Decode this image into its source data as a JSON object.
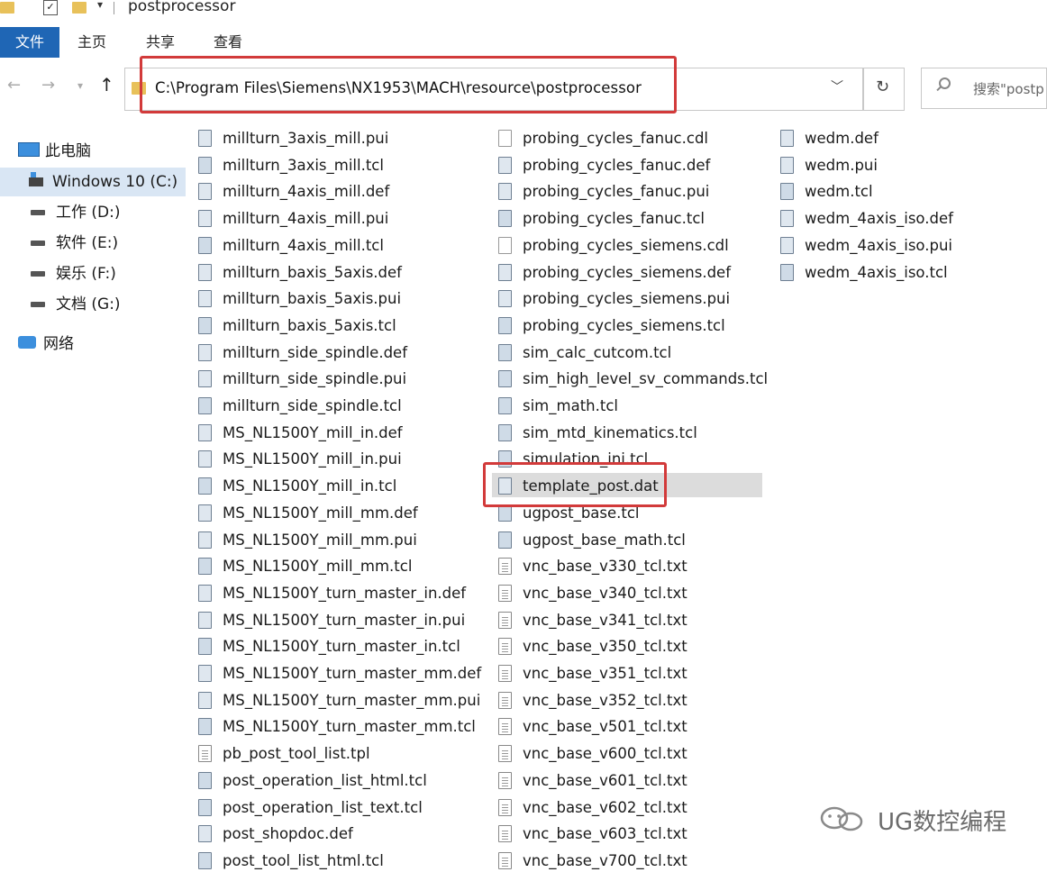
{
  "window": {
    "title": "postprocessor"
  },
  "ribbon": {
    "tabs": [
      "文件",
      "主页",
      "共享",
      "查看"
    ]
  },
  "address": {
    "path": "C:\\Program Files\\Siemens\\NX1953\\MACH\\resource\\postprocessor",
    "search_placeholder": "搜索\"postp"
  },
  "sidebar": {
    "items": [
      {
        "label": "此电脑",
        "icon": "computer-icon"
      },
      {
        "label": "Windows 10 (C:)",
        "icon": "windows-drive-icon",
        "selected": true
      },
      {
        "label": "工作 (D:)",
        "icon": "drive-icon"
      },
      {
        "label": "软件 (E:)",
        "icon": "drive-icon"
      },
      {
        "label": "娱乐 (F:)",
        "icon": "drive-icon"
      },
      {
        "label": "文档 (G:)",
        "icon": "drive-icon"
      },
      {
        "label": "网络",
        "icon": "network-icon"
      }
    ]
  },
  "files": {
    "column1": [
      {
        "name": "millturn_3axis_mill.pui",
        "icon": "file-icon"
      },
      {
        "name": "millturn_3axis_mill.tcl",
        "icon": "tcl-file-icon"
      },
      {
        "name": "millturn_4axis_mill.def",
        "icon": "file-icon"
      },
      {
        "name": "millturn_4axis_mill.pui",
        "icon": "file-icon"
      },
      {
        "name": "millturn_4axis_mill.tcl",
        "icon": "tcl-file-icon"
      },
      {
        "name": "millturn_baxis_5axis.def",
        "icon": "file-icon"
      },
      {
        "name": "millturn_baxis_5axis.pui",
        "icon": "file-icon"
      },
      {
        "name": "millturn_baxis_5axis.tcl",
        "icon": "tcl-file-icon"
      },
      {
        "name": "millturn_side_spindle.def",
        "icon": "file-icon"
      },
      {
        "name": "millturn_side_spindle.pui",
        "icon": "file-icon"
      },
      {
        "name": "millturn_side_spindle.tcl",
        "icon": "tcl-file-icon"
      },
      {
        "name": "MS_NL1500Y_mill_in.def",
        "icon": "file-icon"
      },
      {
        "name": "MS_NL1500Y_mill_in.pui",
        "icon": "file-icon"
      },
      {
        "name": "MS_NL1500Y_mill_in.tcl",
        "icon": "tcl-file-icon"
      },
      {
        "name": "MS_NL1500Y_mill_mm.def",
        "icon": "file-icon"
      },
      {
        "name": "MS_NL1500Y_mill_mm.pui",
        "icon": "file-icon"
      },
      {
        "name": "MS_NL1500Y_mill_mm.tcl",
        "icon": "tcl-file-icon"
      },
      {
        "name": "MS_NL1500Y_turn_master_in.def",
        "icon": "file-icon"
      },
      {
        "name": "MS_NL1500Y_turn_master_in.pui",
        "icon": "file-icon"
      },
      {
        "name": "MS_NL1500Y_turn_master_in.tcl",
        "icon": "tcl-file-icon"
      },
      {
        "name": "MS_NL1500Y_turn_master_mm.def",
        "icon": "file-icon"
      },
      {
        "name": "MS_NL1500Y_turn_master_mm.pui",
        "icon": "file-icon"
      },
      {
        "name": "MS_NL1500Y_turn_master_mm.tcl",
        "icon": "tcl-file-icon"
      },
      {
        "name": "pb_post_tool_list.tpl",
        "icon": "text-file-icon"
      },
      {
        "name": "post_operation_list_html.tcl",
        "icon": "tcl-file-icon"
      },
      {
        "name": "post_operation_list_text.tcl",
        "icon": "tcl-file-icon"
      },
      {
        "name": "post_shopdoc.def",
        "icon": "file-icon"
      },
      {
        "name": "post_tool_list_html.tcl",
        "icon": "tcl-file-icon"
      }
    ],
    "column2": [
      {
        "name": "probing_cycles_fanuc.cdl",
        "icon": "blank-file-icon"
      },
      {
        "name": "probing_cycles_fanuc.def",
        "icon": "file-icon"
      },
      {
        "name": "probing_cycles_fanuc.pui",
        "icon": "file-icon"
      },
      {
        "name": "probing_cycles_fanuc.tcl",
        "icon": "tcl-file-icon"
      },
      {
        "name": "probing_cycles_siemens.cdl",
        "icon": "blank-file-icon"
      },
      {
        "name": "probing_cycles_siemens.def",
        "icon": "file-icon"
      },
      {
        "name": "probing_cycles_siemens.pui",
        "icon": "file-icon"
      },
      {
        "name": "probing_cycles_siemens.tcl",
        "icon": "tcl-file-icon"
      },
      {
        "name": "sim_calc_cutcom.tcl",
        "icon": "tcl-file-icon"
      },
      {
        "name": "sim_high_level_sv_commands.tcl",
        "icon": "tcl-file-icon"
      },
      {
        "name": "sim_math.tcl",
        "icon": "tcl-file-icon"
      },
      {
        "name": "sim_mtd_kinematics.tcl",
        "icon": "tcl-file-icon"
      },
      {
        "name": "simulation_ini.tcl",
        "icon": "tcl-file-icon"
      },
      {
        "name": "template_post.dat",
        "icon": "file-icon",
        "selected": true
      },
      {
        "name": "ugpost_base.tcl",
        "icon": "tcl-file-icon"
      },
      {
        "name": "ugpost_base_math.tcl",
        "icon": "tcl-file-icon"
      },
      {
        "name": "vnc_base_v330_tcl.txt",
        "icon": "text-file-icon"
      },
      {
        "name": "vnc_base_v340_tcl.txt",
        "icon": "text-file-icon"
      },
      {
        "name": "vnc_base_v341_tcl.txt",
        "icon": "text-file-icon"
      },
      {
        "name": "vnc_base_v350_tcl.txt",
        "icon": "text-file-icon"
      },
      {
        "name": "vnc_base_v351_tcl.txt",
        "icon": "text-file-icon"
      },
      {
        "name": "vnc_base_v352_tcl.txt",
        "icon": "text-file-icon"
      },
      {
        "name": "vnc_base_v501_tcl.txt",
        "icon": "text-file-icon"
      },
      {
        "name": "vnc_base_v600_tcl.txt",
        "icon": "text-file-icon"
      },
      {
        "name": "vnc_base_v601_tcl.txt",
        "icon": "text-file-icon"
      },
      {
        "name": "vnc_base_v602_tcl.txt",
        "icon": "text-file-icon"
      },
      {
        "name": "vnc_base_v603_tcl.txt",
        "icon": "text-file-icon"
      },
      {
        "name": "vnc_base_v700_tcl.txt",
        "icon": "text-file-icon"
      }
    ],
    "column3": [
      {
        "name": "wedm.def",
        "icon": "file-icon"
      },
      {
        "name": "wedm.pui",
        "icon": "file-icon"
      },
      {
        "name": "wedm.tcl",
        "icon": "tcl-file-icon"
      },
      {
        "name": "wedm_4axis_iso.def",
        "icon": "file-icon"
      },
      {
        "name": "wedm_4axis_iso.pui",
        "icon": "file-icon"
      },
      {
        "name": "wedm_4axis_iso.tcl",
        "icon": "tcl-file-icon"
      }
    ]
  },
  "watermark": {
    "text": "UG数控编程"
  },
  "colors": {
    "accent": "#1f66b5",
    "highlight_border": "#d23a3a",
    "selection": "#d9e6f4"
  }
}
